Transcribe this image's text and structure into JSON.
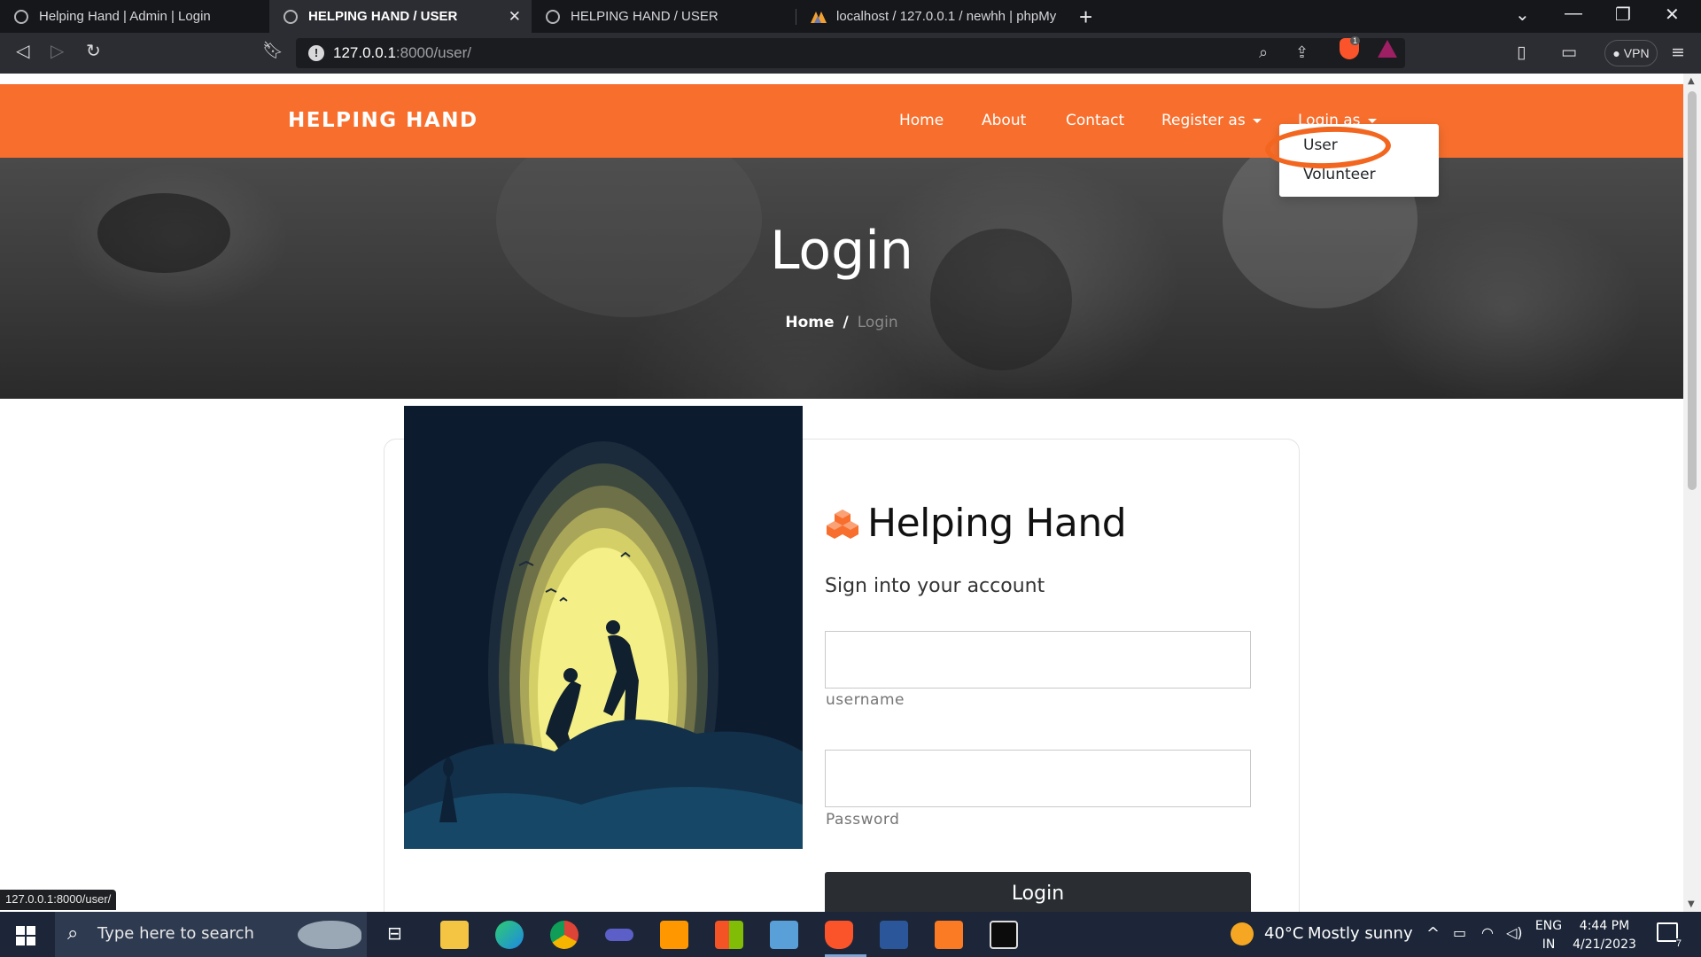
{
  "browser": {
    "tabs": [
      {
        "title": "Helping Hand | Admin | Login",
        "active": false
      },
      {
        "title": "HELPING HAND / USER",
        "active": true
      },
      {
        "title": "HELPING HAND / USER",
        "active": false
      },
      {
        "title": "localhost / 127.0.0.1 / newhh | phpMy",
        "active": false
      }
    ],
    "new_tab": "+",
    "url_host": "127.0.0.1",
    "url_rest": ":8000/user/",
    "vpn_label": "VPN",
    "brave_badge": "1",
    "status_url": "127.0.0.1:8000/user/"
  },
  "site": {
    "brand": "HELPING HAND",
    "nav": {
      "home": "Home",
      "about": "About",
      "contact": "Contact",
      "register": "Register as",
      "login": "Login as"
    },
    "dropdown": [
      "User",
      "Volunteer"
    ],
    "hero": {
      "title": "Login",
      "crumb_home": "Home",
      "crumb_sep": "/",
      "crumb_current": "Login"
    },
    "form": {
      "logo_text": "Helping Hand",
      "subtitle": "Sign into your account",
      "username_label": "username",
      "password_label": "Password",
      "submit_label": "Login"
    }
  },
  "taskbar": {
    "search_placeholder": "Type here to search",
    "weather_temp": "40°C",
    "weather_desc": "Mostly sunny",
    "lang_top": "ENG",
    "lang_bottom": "IN",
    "time": "4:44 PM",
    "date": "4/21/2023",
    "notifications": "7"
  },
  "colors": {
    "accent": "#f86f2d",
    "annotation": "#f2661f",
    "button_dark": "#2a2e33"
  }
}
